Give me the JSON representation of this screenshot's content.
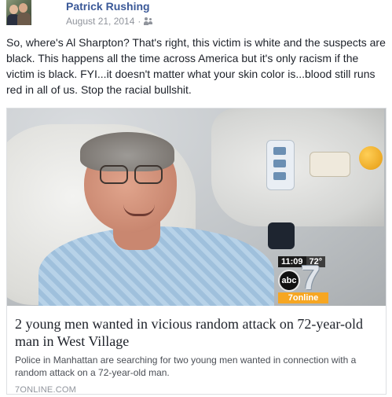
{
  "post": {
    "author": "Patrick Rushing",
    "date": "August 21, 2014",
    "separator": "·",
    "audience_icon": "friends-icon",
    "text": "So, where's Al Sharpton? That's right, this victim is white and the suspects are black. This happens all the time across America but it's only racism if the victim is black. FYI...it doesn't matter what your skin color is...blood still runs red in all of us. Stop the racial bullshit."
  },
  "link_card": {
    "overlay": {
      "time": "11:09",
      "temperature": "72°",
      "network_logo": "abc",
      "channel_number": "7",
      "channel_tag": "7online"
    },
    "title": "2 young men wanted in vicious random attack on 72-year-old man in West Village",
    "description": "Police in Manhattan are searching for two young men wanted in connection with a random attack on a 72-year-old man.",
    "domain": "7ONLINE.COM"
  },
  "colors": {
    "author_link": "#3b5998",
    "meta_gray": "#90949c",
    "text": "#1d2129",
    "card_border": "#dddfe2",
    "channel_orange": "#f6a622"
  }
}
